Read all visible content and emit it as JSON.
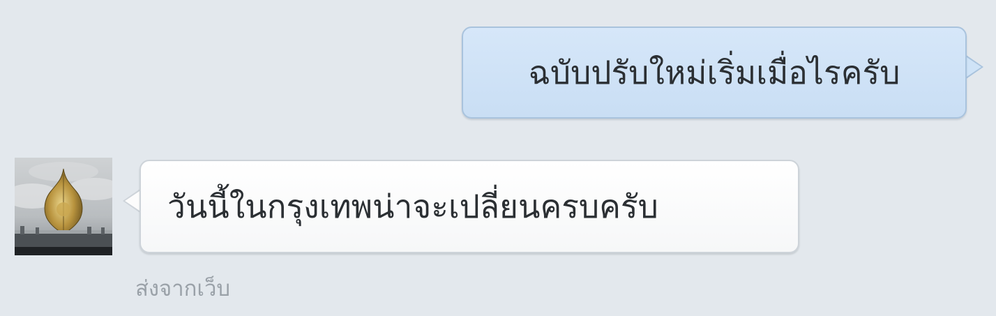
{
  "conversation": {
    "messages": [
      {
        "direction": "outgoing",
        "text": "ฉบับปรับใหม่เริ่มเมื่อไรครับ"
      },
      {
        "direction": "incoming",
        "text": "วันนี้ในกรุงเทพน่าจะเปลี่ยนครบครับ",
        "sent_from": "ส่งจากเว็บ",
        "avatar_icon": "bodhi-leaf-avatar-icon"
      }
    ]
  },
  "colors": {
    "background": "#e3e8ed",
    "outgoing_bubble": "#cfe3f7",
    "incoming_bubble": "#ffffff",
    "meta_text": "#9aa1a8"
  }
}
